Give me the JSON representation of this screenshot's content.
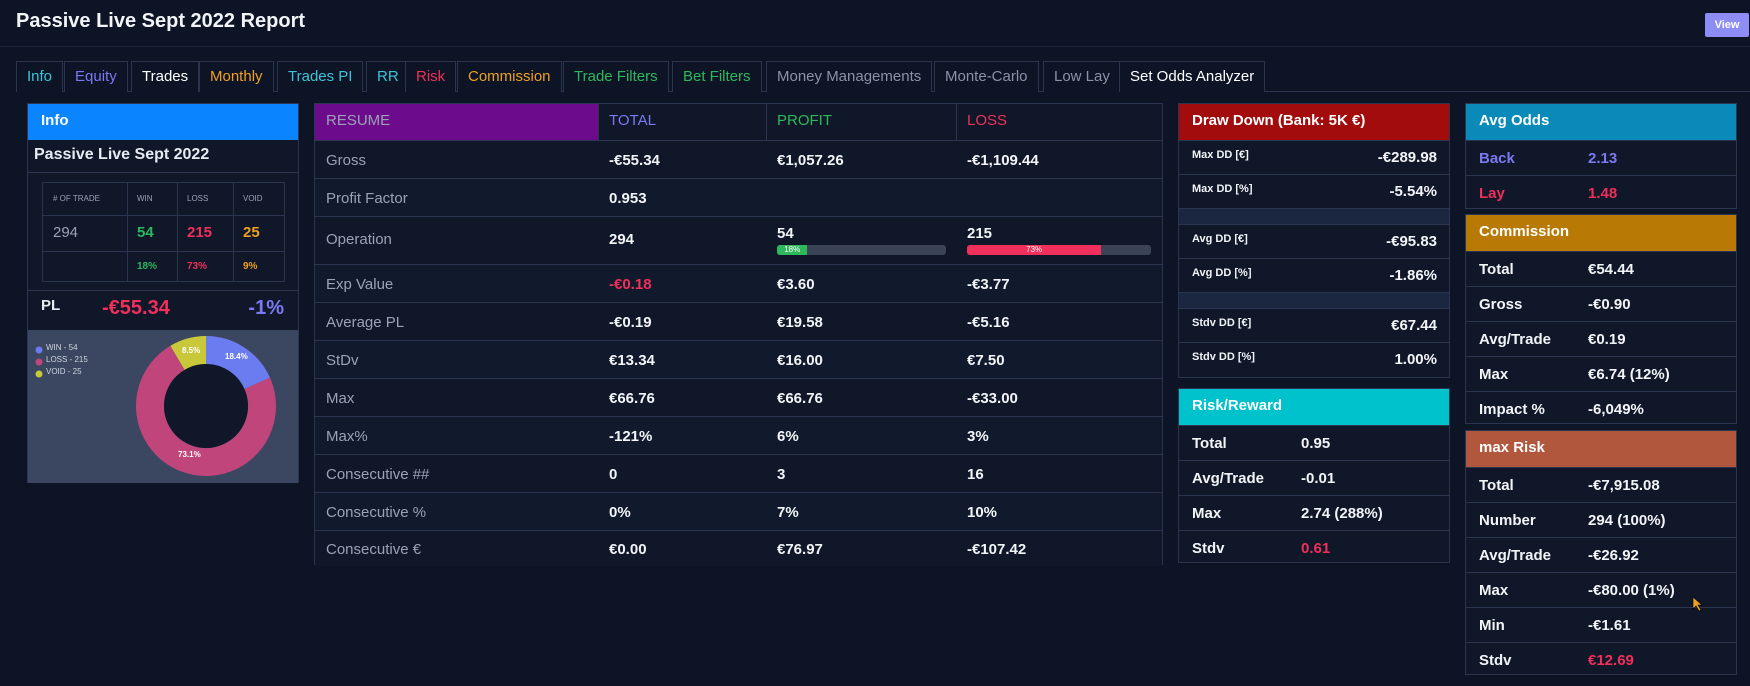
{
  "header": {
    "title": "Passive Live Sept 2022 Report",
    "view_label": "View"
  },
  "tabs": [
    {
      "label": "Info",
      "color": "#3dc4d8"
    },
    {
      "label": "Equity",
      "color": "#7b79f2"
    },
    {
      "label": "Trades",
      "color": "#ffffff"
    },
    {
      "label": "Monthly",
      "color": "#f0a020"
    },
    {
      "label": "Trades PI",
      "color": "#3dc4d8"
    },
    {
      "label": "RR",
      "color": "#3dc4d8"
    },
    {
      "label": "Risk",
      "color": "#f0305a"
    },
    {
      "label": "Commission",
      "color": "#f0a020"
    },
    {
      "label": "Trade Filters",
      "color": "#2eb85c"
    },
    {
      "label": "Bet Filters",
      "color": "#2eb85c"
    },
    {
      "label": "Money Managements",
      "color": "#8a93a6"
    },
    {
      "label": "Monte-Carlo",
      "color": "#8a93a6"
    },
    {
      "label": "Low Lay",
      "color": "#8a93a6"
    },
    {
      "label": "Set Odds Analyzer",
      "color": "#ffffff"
    }
  ],
  "info": {
    "header": "Info",
    "name": "Passive Live Sept 2022",
    "cols": [
      "# OF TRADE",
      "WIN",
      "LOSS",
      "VOID"
    ],
    "counts": [
      "294",
      "54",
      "215",
      "25"
    ],
    "pcts": [
      "",
      "18%",
      "73%",
      "9%"
    ],
    "pl_label": "PL",
    "pl_value": "-€55.34",
    "pl_pct": "-1%",
    "legend": [
      "WIN - 54",
      "LOSS - 215",
      "VOID - 25"
    ],
    "slice_labels": [
      "18.4%",
      "73.1%",
      "8.5%"
    ]
  },
  "chart_data": {
    "type": "pie",
    "categories": [
      "WIN - 54",
      "LOSS - 215",
      "VOID - 25"
    ],
    "values": [
      54,
      215,
      25
    ],
    "percent_labels": [
      "18.4%",
      "73.1%",
      "8.5%"
    ],
    "colors": [
      "#6b7cf0",
      "#c0457a",
      "#c8c83a"
    ],
    "legend_position": "top-left",
    "donut": true
  },
  "resume": {
    "headers": [
      "RESUME",
      "TOTAL",
      "PROFIT",
      "LOSS"
    ],
    "rows": [
      {
        "label": "Gross",
        "total": "-€55.34",
        "profit": "€1,057.26",
        "loss": "-€1,109.44"
      },
      {
        "label": "Profit Factor",
        "total": "0.953",
        "profit": "",
        "loss": ""
      },
      {
        "label": "Operation",
        "total": "294",
        "profit": "54",
        "loss": "215"
      },
      {
        "label": "Exp Value",
        "total": "-€0.18",
        "profit": "€3.60",
        "loss": "-€3.77"
      },
      {
        "label": "Average PL",
        "total": "-€0.19",
        "profit": "€19.58",
        "loss": "-€5.16"
      },
      {
        "label": "StDv",
        "total": "€13.34",
        "profit": "€16.00",
        "loss": "€7.50"
      },
      {
        "label": "Max",
        "total": "€66.76",
        "profit": "€66.76",
        "loss": "-€33.00"
      },
      {
        "label": "Max%",
        "total": "-121%",
        "profit": "6%",
        "loss": "3%"
      },
      {
        "label": "Consecutive ##",
        "total": "0",
        "profit": "3",
        "loss": "16"
      },
      {
        "label": "Consecutive %",
        "total": "0%",
        "profit": "7%",
        "loss": "10%"
      },
      {
        "label": "Consecutive €",
        "total": "€0.00",
        "profit": "€76.97",
        "loss": "-€107.42"
      }
    ],
    "profit_bar_label": "18%",
    "profit_bar_fraction": 0.18,
    "loss_bar_label": "73%",
    "loss_bar_fraction": 0.73
  },
  "drawdown": {
    "header": "Draw Down (Bank: 5K €)",
    "rows": [
      {
        "label": "Max DD [€]",
        "value": "-€289.98"
      },
      {
        "label": "Max DD [%]",
        "value": "-5.54%"
      },
      {
        "label": "Avg DD [€]",
        "value": "-€95.83"
      },
      {
        "label": "Avg DD [%]",
        "value": "-1.86%"
      },
      {
        "label": "Stdv DD [€]",
        "value": "€67.44"
      },
      {
        "label": "Stdv DD [%]",
        "value": "1.00%"
      }
    ]
  },
  "riskreward": {
    "header": "Risk/Reward",
    "rows": [
      {
        "label": "Total",
        "value": "0.95"
      },
      {
        "label": "Avg/Trade",
        "value": "-0.01"
      },
      {
        "label": "Max",
        "value": "2.74 (288%)"
      },
      {
        "label": "Stdv",
        "value": "0.61"
      }
    ]
  },
  "avgodds": {
    "header": "Avg Odds",
    "rows": [
      {
        "label": "Back",
        "value": "2.13"
      },
      {
        "label": "Lay",
        "value": "1.48"
      }
    ]
  },
  "commission": {
    "header": "Commission",
    "rows": [
      {
        "label": "Total",
        "value": "€54.44"
      },
      {
        "label": "Gross",
        "value": "-€0.90"
      },
      {
        "label": "Avg/Trade",
        "value": "€0.19"
      },
      {
        "label": "Max",
        "value": "€6.74 (12%)"
      },
      {
        "label": "Impact %",
        "value": "-6,049%"
      }
    ]
  },
  "maxrisk": {
    "header": "max Risk",
    "rows": [
      {
        "label": "Total",
        "value": "-€7,915.08"
      },
      {
        "label": "Number",
        "value": "294 (100%)"
      },
      {
        "label": "Avg/Trade",
        "value": "-€26.92"
      },
      {
        "label": "Max",
        "value": "-€80.00 (1%)"
      },
      {
        "label": "Min",
        "value": "-€1.61"
      },
      {
        "label": "Stdv",
        "value": "€12.69"
      }
    ]
  },
  "colors": {
    "info_header": "#0a84ff",
    "resume_header": "#6c0b8c",
    "drawdown_header": "#a30c0c",
    "riskreward_header": "#00c2cc",
    "avgodds_header": "#0a8ab8",
    "commission_header": "#b87a05",
    "maxrisk_header": "#b0573e",
    "total": "#7b79f2",
    "profit": "#2eb85c",
    "loss": "#f0305a",
    "void": "#f0a020"
  }
}
